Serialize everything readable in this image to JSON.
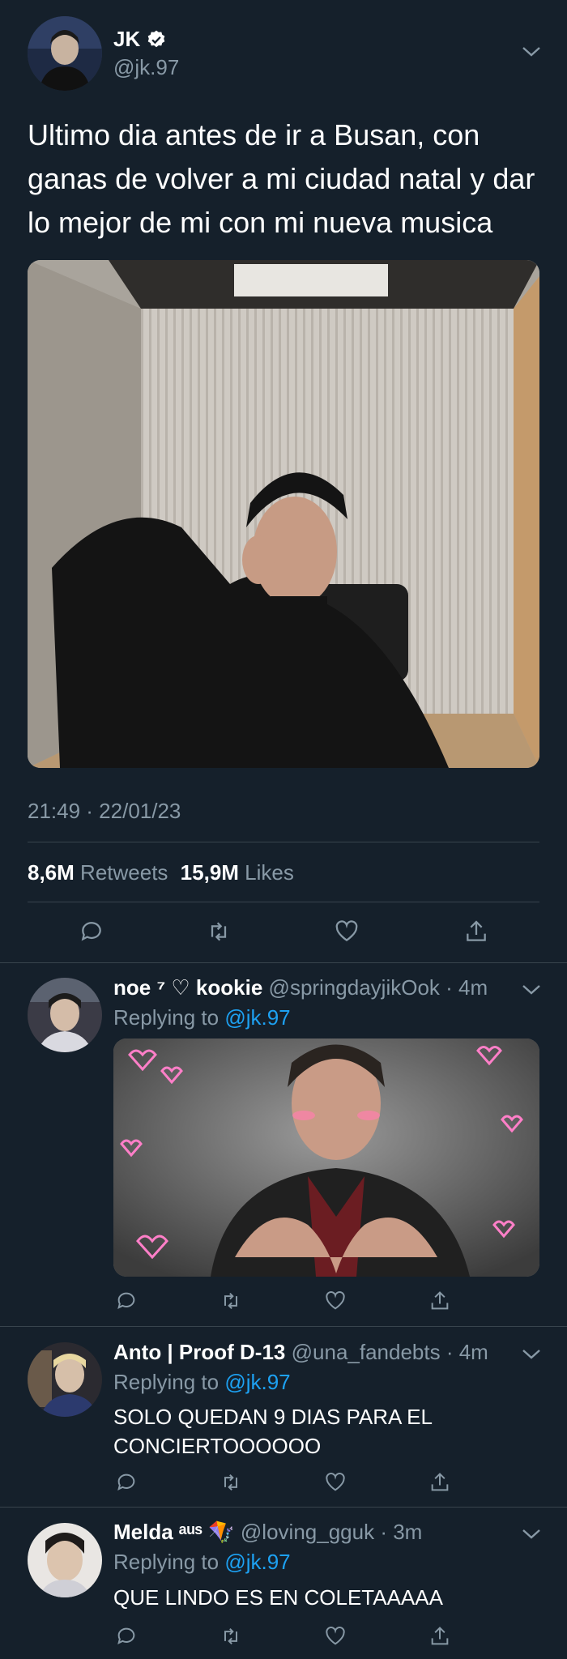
{
  "tweet": {
    "author_name": "JK",
    "author_handle": "@jk.97",
    "text_line1": "Ultimo dia antes de ir a Busan, con",
    "text_line2": "ganas de volver a mi ciudad natal y dar",
    "text_line3": "lo mejor de mi con mi nueva musica",
    "timestamp": "21:49 · 22/01/23",
    "retweets_count": "8,6M",
    "retweets_label": "Retweets",
    "likes_count": "15,9M",
    "likes_label": "Likes"
  },
  "replies": [
    {
      "name": "noe ⁷ ♡ kookie",
      "handle": "@springdayjikOok",
      "time": "· 4m",
      "replying_prefix": "Replying to",
      "replying_to": "@jk.97",
      "text_line1": "",
      "text_line2": ""
    },
    {
      "name": "Anto | Proof D-13",
      "handle": "@una_fandebts",
      "time": "· 4m",
      "replying_prefix": "Replying to",
      "replying_to": "@jk.97",
      "text_line1": "SOLO QUEDAN 9 DIAS PARA EL",
      "text_line2": "CONCIERTOOOOOO"
    },
    {
      "name": "Melda ᵃᵘˢ 🪁",
      "handle": "@loving_gguk",
      "time": "· 3m",
      "replying_prefix": "Replying to",
      "replying_to": "@jk.97",
      "text_line1": "QUE LINDO ES EN COLETAAAAA",
      "text_line2": ""
    }
  ],
  "colors": {
    "background": "#15202b",
    "muted": "#8899a6",
    "link": "#1da1f2",
    "divider": "#38444d"
  },
  "icons": {
    "verified": "verified-badge-icon",
    "chevron": "chevron-down-icon",
    "reply": "reply-icon",
    "retweet": "retweet-icon",
    "like": "heart-icon",
    "share": "share-icon"
  }
}
